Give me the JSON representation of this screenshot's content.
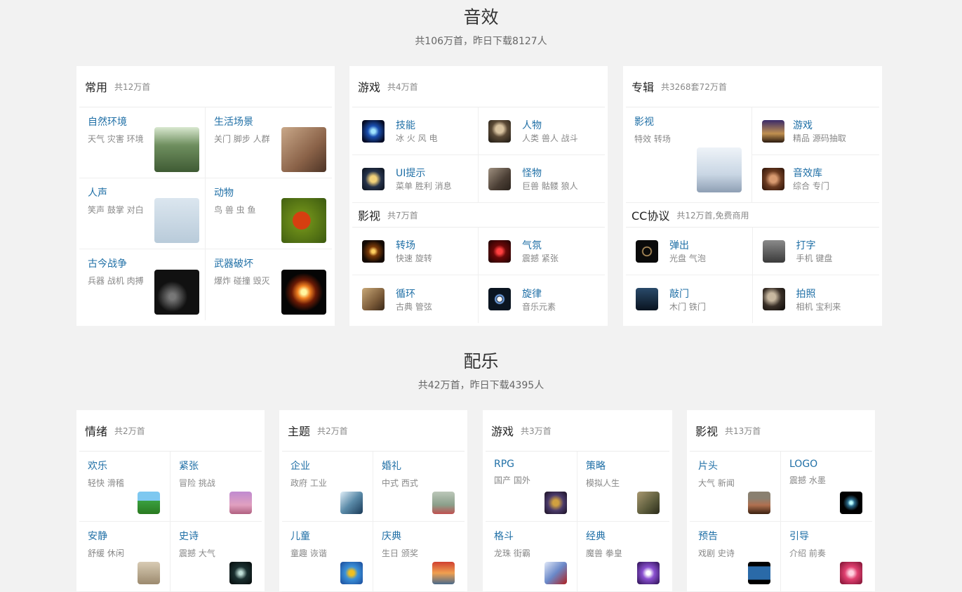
{
  "sfx": {
    "title": "音效",
    "subtitle": "共106万首，昨日下载8127人",
    "common": {
      "title": "常用",
      "count": "共12万首",
      "items": [
        {
          "name": "自然环境",
          "tags": "天气 灾害 环境",
          "icon": "forest-thumb"
        },
        {
          "name": "生活场景",
          "tags": "关门 脚步 人群",
          "icon": "footprints-thumb"
        },
        {
          "name": "人声",
          "tags": "笑声 鼓掌 对白",
          "icon": "voice-thumb"
        },
        {
          "name": "动物",
          "tags": "鸟 兽 虫 鱼",
          "icon": "ladybug-thumb"
        },
        {
          "name": "古今战争",
          "tags": "兵器 战机 肉搏",
          "icon": "sword-thumb"
        },
        {
          "name": "武器破坏",
          "tags": "爆炸 碰撞 毁灭",
          "icon": "explosion-thumb"
        }
      ]
    },
    "game": {
      "title": "游戏",
      "count": "共4万首",
      "items": [
        {
          "name": "技能",
          "tags": "冰 火 风 电",
          "icon": "skill-icon"
        },
        {
          "name": "人物",
          "tags": "人类 兽人 战斗",
          "icon": "character-icon"
        },
        {
          "name": "UI提示",
          "tags": "菜单 胜利 消息",
          "icon": "ui-icon"
        },
        {
          "name": "怪物",
          "tags": "巨兽 骷髅 狼人",
          "icon": "monster-icon"
        }
      ]
    },
    "film": {
      "title": "影视",
      "count": "共7万首",
      "items": [
        {
          "name": "转场",
          "tags": "快速 旋转",
          "icon": "transition-icon"
        },
        {
          "name": "气氛",
          "tags": "震撼 紧张",
          "icon": "atmosphere-icon"
        },
        {
          "name": "循环",
          "tags": "古典 管弦",
          "icon": "loop-icon"
        },
        {
          "name": "旋律",
          "tags": "音乐元素",
          "icon": "melody-icon"
        }
      ]
    },
    "album": {
      "title": "专辑",
      "count": "共3268套72万首",
      "feature": {
        "name": "影视",
        "tags": "特效 转场",
        "icon": "film-album-thumb"
      },
      "items": [
        {
          "name": "游戏",
          "tags": "精品 源码抽取",
          "icon": "game-album-icon"
        },
        {
          "name": "音效库",
          "tags": "综合 专门",
          "icon": "library-icon"
        }
      ]
    },
    "cc": {
      "title": "CC协议",
      "count": "共12万首,免费商用",
      "items": [
        {
          "name": "弹出",
          "tags": "光盘 气泡",
          "icon": "popup-icon"
        },
        {
          "name": "打字",
          "tags": "手机 键盘",
          "icon": "typing-icon"
        },
        {
          "name": "敲门",
          "tags": "木门 铁门",
          "icon": "knock-icon"
        },
        {
          "name": "拍照",
          "tags": "相机 宝利来",
          "icon": "camera-icon"
        }
      ]
    }
  },
  "music": {
    "title": "配乐",
    "subtitle": "共42万首，昨日下载4395人",
    "emotion": {
      "title": "情绪",
      "count": "共2万首",
      "items": [
        {
          "name": "欢乐",
          "tags": "轻快 滑稽",
          "icon": "tree-icon"
        },
        {
          "name": "紧张",
          "tags": "冒险 挑战",
          "icon": "tension-icon"
        },
        {
          "name": "安静",
          "tags": "舒缓 休闲",
          "icon": "love-icon"
        },
        {
          "name": "史诗",
          "tags": "震撼 大气",
          "icon": "epic-icon"
        }
      ]
    },
    "theme": {
      "title": "主题",
      "count": "共2万首",
      "items": [
        {
          "name": "企业",
          "tags": "政府 工业",
          "icon": "enterprise-icon"
        },
        {
          "name": "婚礼",
          "tags": "中式 西式",
          "icon": "wedding-icon"
        },
        {
          "name": "儿童",
          "tags": "童趣 诙谐",
          "icon": "kids-icon"
        },
        {
          "name": "庆典",
          "tags": "生日 颁奖",
          "icon": "celebration-icon"
        }
      ]
    },
    "game": {
      "title": "游戏",
      "count": "共3万首",
      "items": [
        {
          "name": "RPG",
          "tags": "国产 国外",
          "icon": "rpg-icon"
        },
        {
          "name": "策略",
          "tags": "模拟人生",
          "icon": "strategy-icon"
        },
        {
          "name": "格斗",
          "tags": "龙珠 街霸",
          "icon": "fight-icon"
        },
        {
          "name": "经典",
          "tags": "魔兽 拳皇",
          "icon": "classic-icon"
        }
      ]
    },
    "film": {
      "title": "影视",
      "count": "共13万首",
      "items": [
        {
          "name": "片头",
          "tags": "大气 新闻",
          "icon": "opening-icon"
        },
        {
          "name": "LOGO",
          "tags": "震撼 水墨",
          "icon": "logo-icon"
        },
        {
          "name": "预告",
          "tags": "戏剧 史诗",
          "icon": "trailer-icon"
        },
        {
          "name": "引导",
          "tags": "介绍 前奏",
          "icon": "intro-icon"
        }
      ]
    }
  }
}
